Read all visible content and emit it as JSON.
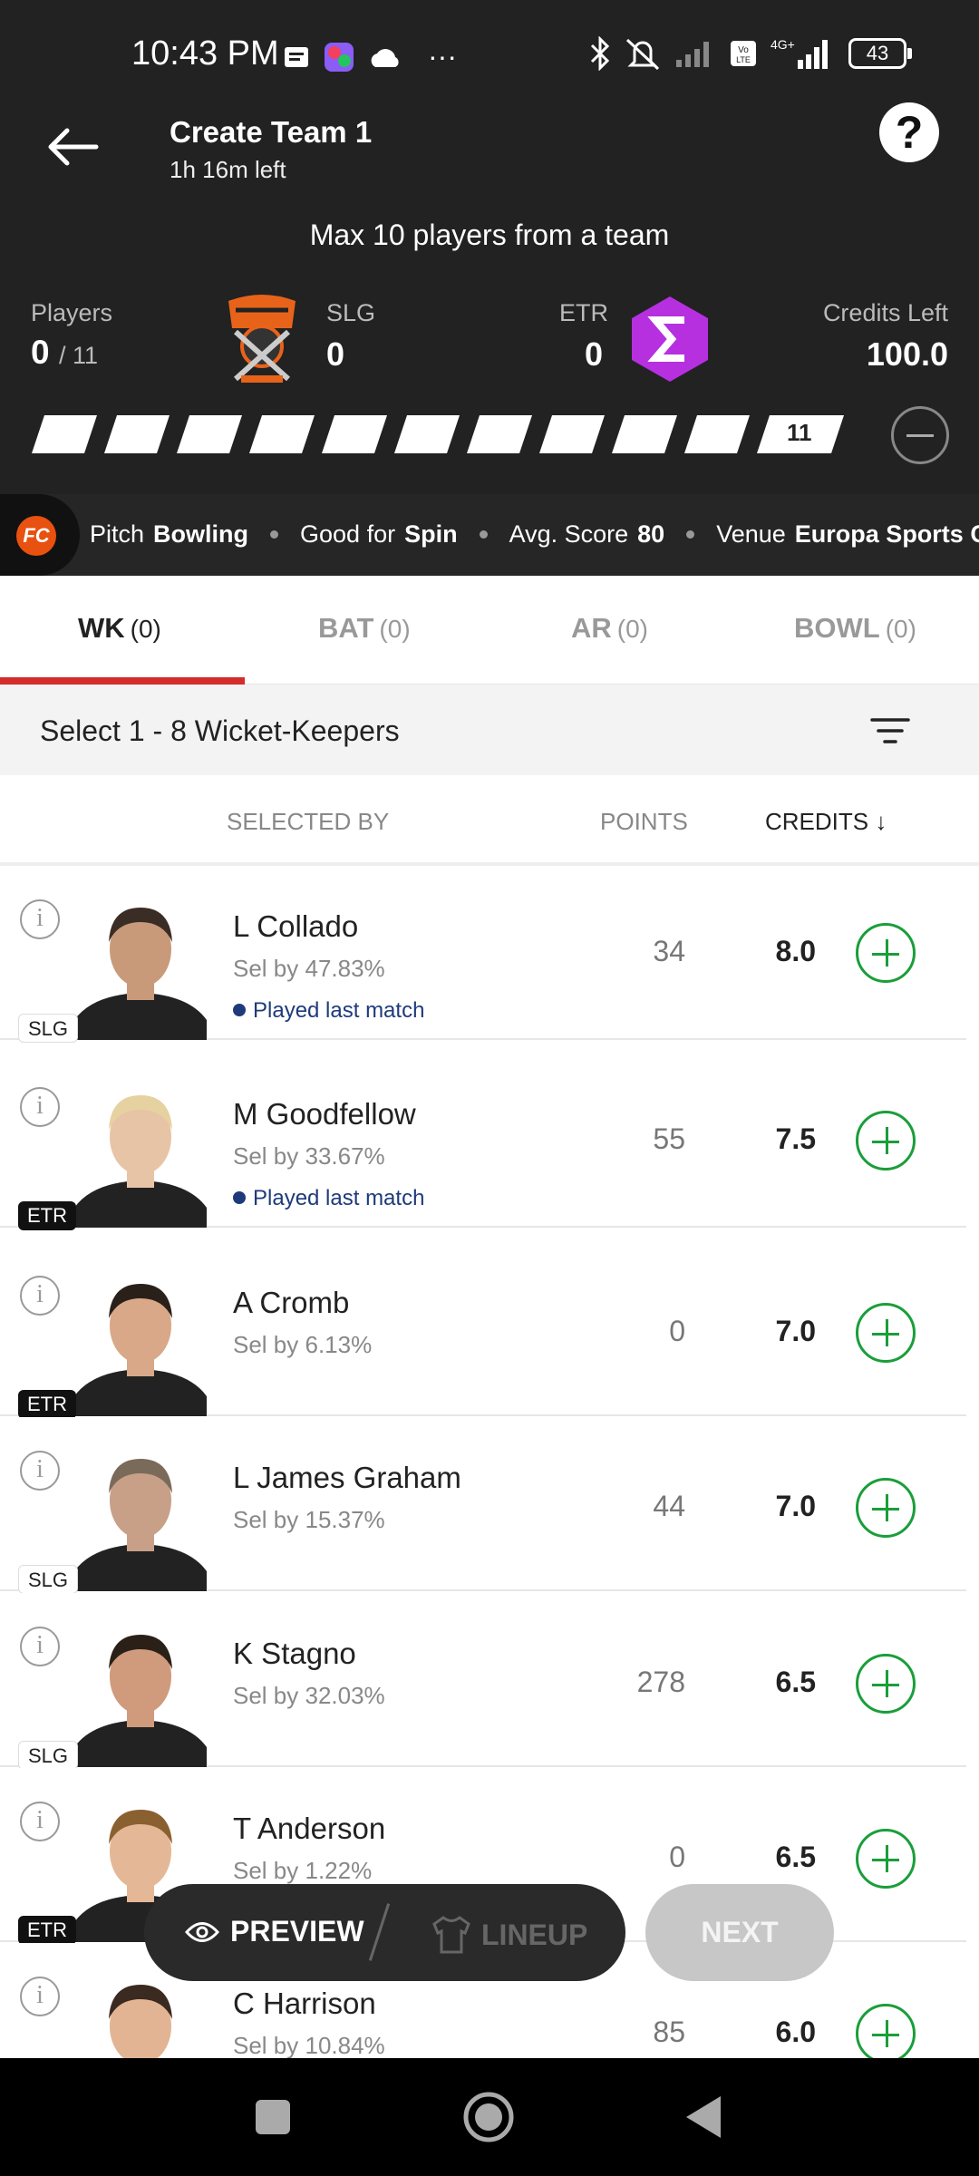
{
  "status_bar": {
    "time": "10:43 PM",
    "more": "···",
    "battery": "43"
  },
  "header": {
    "title": "Create Team 1",
    "subtitle": "1h 16m left",
    "help": "?",
    "max_note": "Max 10 players from a team",
    "players_label": "Players",
    "players_selected": "0",
    "players_total": "/ 11",
    "team1_name": "SLG",
    "team1_count": "0",
    "team2_name": "ETR",
    "team2_count": "0",
    "credits_label": "Credits Left",
    "credits_value": "100.0",
    "progress_end": "11"
  },
  "info_strip": {
    "pitch_label": "Pitch",
    "pitch_value": "Bowling",
    "good_label": "Good for",
    "good_value": "Spin",
    "avg_label": "Avg. Score",
    "avg_value": "80",
    "venue_label": "Venue",
    "venue_value": "Europa Sports C"
  },
  "tabs": [
    {
      "label": "WK",
      "count": "(0)"
    },
    {
      "label": "BAT",
      "count": "(0)"
    },
    {
      "label": "AR",
      "count": "(0)"
    },
    {
      "label": "BOWL",
      "count": "(0)"
    }
  ],
  "select_hint": "Select 1 - 8 Wicket-Keepers",
  "columns": {
    "selected_by": "SELECTED BY",
    "points": "POINTS",
    "credits": "CREDITS ↓"
  },
  "players": [
    {
      "name": "L Collado",
      "sel": "Sel by 47.83%",
      "played": "Played last match",
      "team": "SLG",
      "points": "34",
      "credits": "8.0"
    },
    {
      "name": "M Goodfellow",
      "sel": "Sel by 33.67%",
      "played": "Played last match",
      "team": "ETR",
      "points": "55",
      "credits": "7.5"
    },
    {
      "name": "A Cromb",
      "sel": "Sel by 6.13%",
      "played": "",
      "team": "ETR",
      "points": "0",
      "credits": "7.0"
    },
    {
      "name": "L James Graham",
      "sel": "Sel by 15.37%",
      "played": "",
      "team": "SLG",
      "points": "44",
      "credits": "7.0"
    },
    {
      "name": "K Stagno",
      "sel": "Sel by 32.03%",
      "played": "",
      "team": "SLG",
      "points": "278",
      "credits": "6.5"
    },
    {
      "name": "T Anderson",
      "sel": "Sel by 1.22%",
      "played": "",
      "team": "ETR",
      "points": "0",
      "credits": "6.5"
    },
    {
      "name": "C Harrison",
      "sel": "Sel by 10.84%",
      "played": "",
      "team": "",
      "points": "85",
      "credits": "6.0"
    }
  ],
  "actions": {
    "preview": "PREVIEW",
    "lineup": "LINEUP",
    "next": "NEXT"
  },
  "colors": {
    "header_bg": "#222222",
    "accent_red": "#d42b2b",
    "add_green": "#1a9e3a",
    "etr_purple": "#b730e0"
  }
}
